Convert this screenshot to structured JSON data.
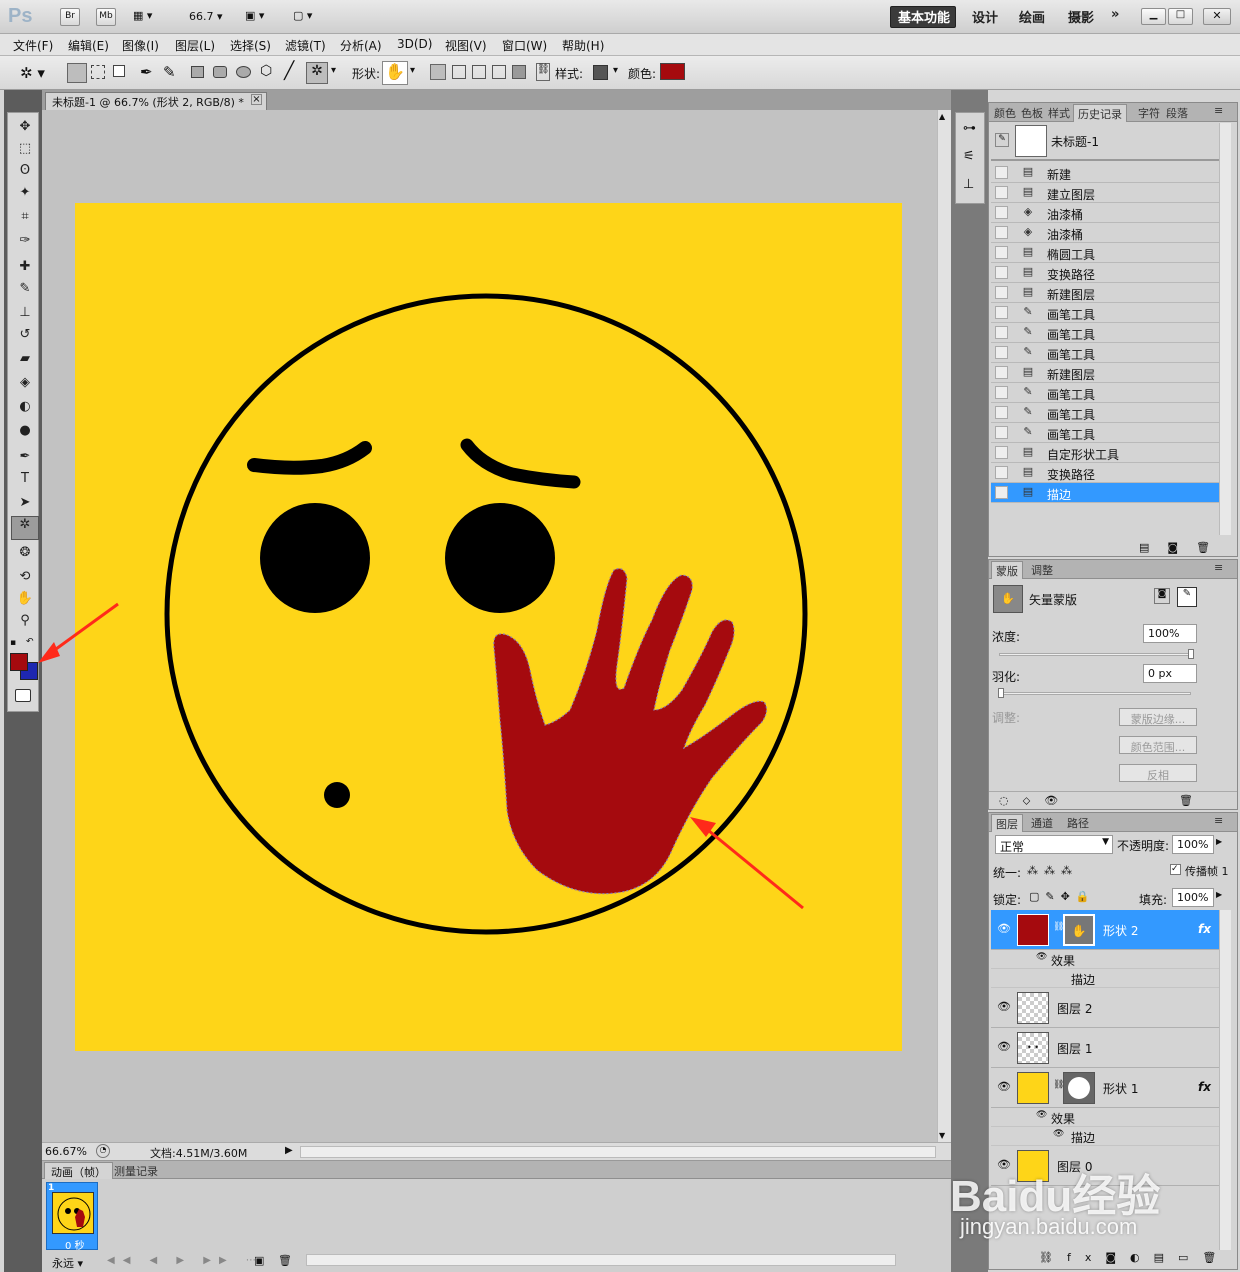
{
  "app": {
    "logo": "Ps",
    "bridge": "Br",
    "minibridge": "Mb",
    "zoom_combo": "66.7"
  },
  "workspaces": [
    "基本功能",
    "设计",
    "绘画",
    "摄影",
    "»"
  ],
  "menus": [
    "文件(F)",
    "编辑(E)",
    "图像(I)",
    "图层(L)",
    "选择(S)",
    "滤镜(T)",
    "分析(A)",
    "3D(D)",
    "视图(V)",
    "窗口(W)",
    "帮助(H)"
  ],
  "options": {
    "shape_label": "形状:",
    "style_label": "样式:",
    "color_label": "颜色:",
    "color_value": "#a50a0e"
  },
  "document": {
    "tab_title": "未标题-1 @ 66.7% (形状 2, RGB/8) *",
    "zoom": "66.67%",
    "doc_size": "文档:4.51M/3.60M"
  },
  "canvas_colors": {
    "background": "#fed518",
    "hand": "#a50a0e",
    "ink": "#000000"
  },
  "toolbox": {
    "fg_color": "#a50a0e",
    "bg_color": "#1e27b0"
  },
  "bottom": {
    "tab_anim": "动画（帧）",
    "tab_measure": "测量记录",
    "frame_number": "1",
    "frame_time": "0 秒",
    "loop": "永远"
  },
  "history": {
    "tabs": [
      "颜色",
      "色板",
      "样式",
      "历史记录",
      "字符",
      "段落"
    ],
    "snapshot": "未标题-1",
    "items": [
      {
        "label": "新建",
        "icon": "doc-icon"
      },
      {
        "label": "建立图层",
        "icon": "doc-icon"
      },
      {
        "label": "油漆桶",
        "icon": "bucket-icon"
      },
      {
        "label": "油漆桶",
        "icon": "bucket-icon"
      },
      {
        "label": "椭圆工具",
        "icon": "doc-icon"
      },
      {
        "label": "变换路径",
        "icon": "doc-icon"
      },
      {
        "label": "新建图层",
        "icon": "doc-icon"
      },
      {
        "label": "画笔工具",
        "icon": "brush-icon"
      },
      {
        "label": "画笔工具",
        "icon": "brush-icon"
      },
      {
        "label": "画笔工具",
        "icon": "brush-icon"
      },
      {
        "label": "新建图层",
        "icon": "doc-icon"
      },
      {
        "label": "画笔工具",
        "icon": "brush-icon"
      },
      {
        "label": "画笔工具",
        "icon": "brush-icon"
      },
      {
        "label": "画笔工具",
        "icon": "brush-icon"
      },
      {
        "label": "自定形状工具",
        "icon": "doc-icon"
      },
      {
        "label": "变换路径",
        "icon": "doc-icon"
      },
      {
        "label": "描边",
        "icon": "doc-icon",
        "selected": true
      }
    ]
  },
  "masks": {
    "tabs": [
      "蒙版",
      "调整"
    ],
    "title": "矢量蒙版",
    "density_label": "浓度:",
    "density_value": "100%",
    "feather_label": "羽化:",
    "feather_value": "0 px",
    "refine_label": "调整:",
    "btn_edge": "蒙版边缘...",
    "btn_range": "颜色范围...",
    "btn_invert": "反相"
  },
  "layers": {
    "tabs": [
      "图层",
      "通道",
      "路径"
    ],
    "blend": "正常",
    "opacity_label": "不透明度:",
    "opacity": "100%",
    "unify_label": "统一:",
    "propagate_label": "传播帧 1",
    "lock_label": "锁定:",
    "fill_label": "填充:",
    "fill": "100%",
    "effects_label": "效果",
    "stroke_label": "描边",
    "fx": "fx",
    "items": [
      {
        "name": "形状 2"
      },
      {
        "name": "图层 2"
      },
      {
        "name": "图层 1"
      },
      {
        "name": "形状 1"
      },
      {
        "name": "图层 0"
      }
    ]
  },
  "watermark": {
    "brand": "Baidu经验",
    "url": "jingyan.baidu.com"
  }
}
